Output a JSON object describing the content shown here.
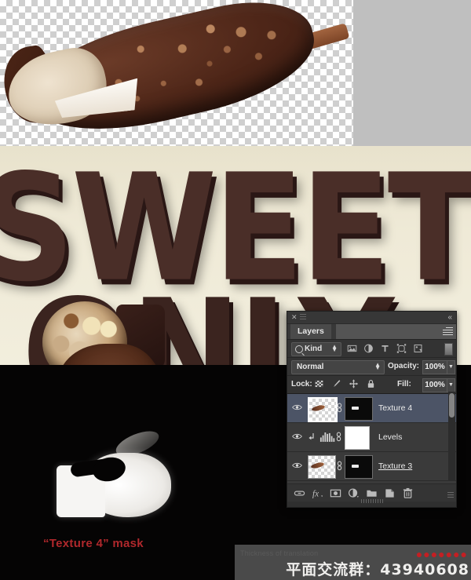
{
  "image": {
    "top_band": {
      "alt": "chocolate-covered ice cream bar on transparent background"
    },
    "poster_band": {
      "letters_line1": "SWEET",
      "letters_line2": "ONLY"
    },
    "mask_band": {
      "caption": "“Texture 4” mask"
    }
  },
  "watermark": {
    "faint_text": "Thickness of translation",
    "logo_text": "●●●●●●●",
    "qq_text": "平面交流群：43940608"
  },
  "layers_panel": {
    "close_label": "✕",
    "collapse_label": "«",
    "tab_label": "Layers",
    "filter": {
      "kind_label": "Kind",
      "search_icon": "search-icon",
      "icons": [
        "pixel-layer-filter-icon",
        "adjustment-layer-filter-icon",
        "type-layer-filter-icon",
        "shape-layer-filter-icon",
        "smart-object-filter-icon"
      ],
      "toggle_name": "filter-enable-toggle"
    },
    "blend": {
      "mode": "Normal",
      "opacity_label": "Opacity:",
      "opacity_value": "100%"
    },
    "lock": {
      "label": "Lock:",
      "icons": [
        "lock-transparent-pixels-icon",
        "lock-image-pixels-icon",
        "lock-position-icon",
        "lock-all-icon"
      ],
      "fill_label": "Fill:",
      "fill_value": "100%"
    },
    "rows": [
      {
        "name": "Texture 4",
        "selected": true,
        "visible": true,
        "has_layer_thumb": true,
        "has_mask_thumb": true,
        "mask_type": "black",
        "linked": true,
        "underline": false
      },
      {
        "name": "Levels",
        "selected": false,
        "visible": true,
        "has_layer_thumb": false,
        "has_mask_thumb": true,
        "mask_type": "white",
        "linked": true,
        "clipped": true,
        "underline": false
      },
      {
        "name": "Texture 3",
        "selected": false,
        "visible": true,
        "has_layer_thumb": true,
        "has_mask_thumb": true,
        "mask_type": "black",
        "linked": true,
        "underline": true
      }
    ],
    "bottom_icons": [
      "link-layers-icon",
      "layer-style-fx-icon",
      "add-layer-mask-icon",
      "new-adjustment-layer-icon",
      "new-group-icon",
      "new-layer-icon",
      "delete-layer-icon"
    ]
  },
  "colors": {
    "panel_bg": "#2f2f2f",
    "row_selected": "#4c5466",
    "caption_red": "#b0282c",
    "poster_bg": "#efead7",
    "chocolate": "#4a2e28"
  }
}
